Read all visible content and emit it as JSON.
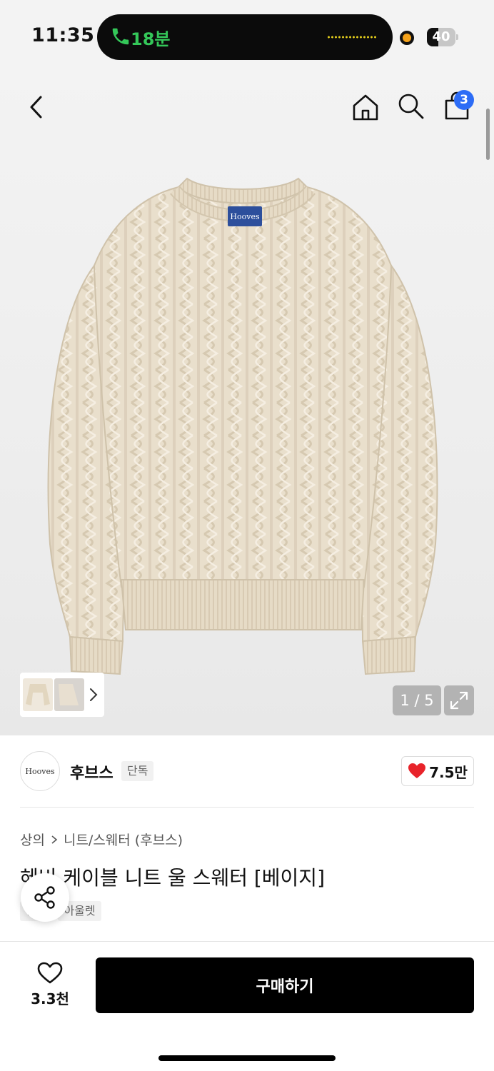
{
  "status_bar": {
    "time": "11:35",
    "call_duration": "18분",
    "battery_level": "40",
    "battery_fraction": 0.4
  },
  "header": {
    "cart_count": "3",
    "icons": [
      "back-chevron-icon",
      "home-icon",
      "search-icon",
      "shopping-bag-icon"
    ]
  },
  "gallery": {
    "pager_text": "1 / 5",
    "image_brand_label": "Hooves"
  },
  "brand": {
    "logo_text": "Hooves",
    "name": "후브스",
    "tag": "단독",
    "like_count": "7.5만"
  },
  "product": {
    "breadcrumb": [
      "상의",
      "니트/스웨터 (후브스)"
    ],
    "title": "헤비 케이블 니트 울 스웨터 [베이지]",
    "tags": [
      "단독",
      "아울렛"
    ]
  },
  "bottom": {
    "wish_count": "3.3천",
    "buy_label": "구매하기"
  },
  "colors": {
    "accent_blue": "#2c6cf6",
    "heart_red": "#e8232a",
    "call_green": "#34c759",
    "sweater_beige": "#e9dfcc"
  }
}
